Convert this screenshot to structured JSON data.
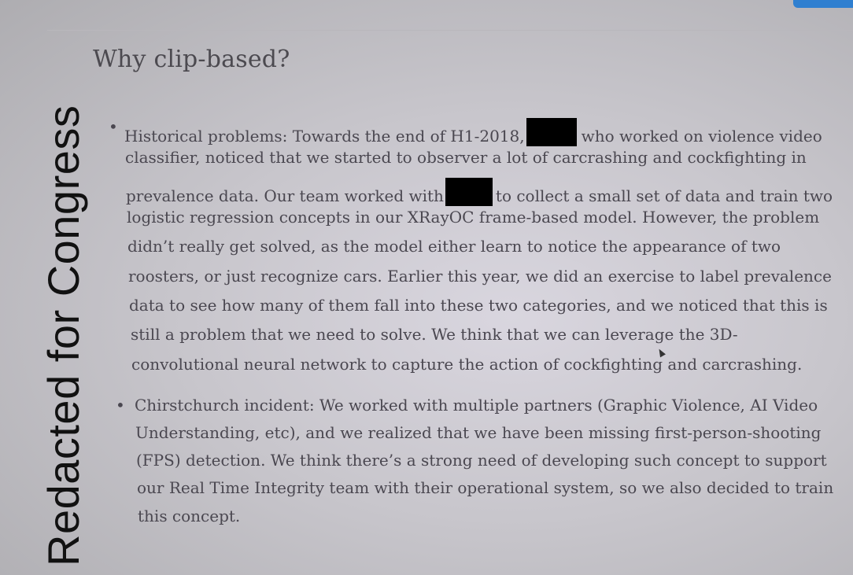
{
  "watermark": "Redacted for Congress",
  "section_title": "Why clip-based?",
  "bullets": [
    {
      "lines": [
        {
          "pre": "Historical problems: Towards the end of H1-2018,",
          "post": "who worked on violence video"
        },
        {
          "text": "classifier, noticed that we started to observer a lot of carcrashing and cockfighting in"
        },
        {
          "pre": "prevalence data. Our team worked with",
          "post": "to collect a small set of data and train two"
        },
        {
          "text": "logistic regression concepts in our XRayOC frame-based model. However, the problem"
        },
        {
          "text": "didn’t really get solved, as the model either learn to notice the appearance of two"
        },
        {
          "text": "roosters, or just recognize cars. Earlier this year, we did an exercise to label prevalence"
        },
        {
          "text": "data to see how many of them fall into these two categories, and we noticed that this is"
        },
        {
          "text": "still a problem that we need  to solve. We think that we can leverage the 3D-"
        },
        {
          "text": "convolutional neural network to capture the action of cockfighting and carcrashing."
        }
      ]
    },
    {
      "lines": [
        {
          "text": "Chirstchurch incident: We worked with multiple partners (Graphic Violence, AI Video"
        },
        {
          "text": "Understanding, etc), and we realized that we have been missing first-person-shooting"
        },
        {
          "text": "(FPS) detection. We think there’s a strong need of developing such concept to support"
        },
        {
          "text": "our Real Time Integrity team with their operational system, so we also decided to train"
        },
        {
          "text": "this concept."
        }
      ]
    }
  ]
}
